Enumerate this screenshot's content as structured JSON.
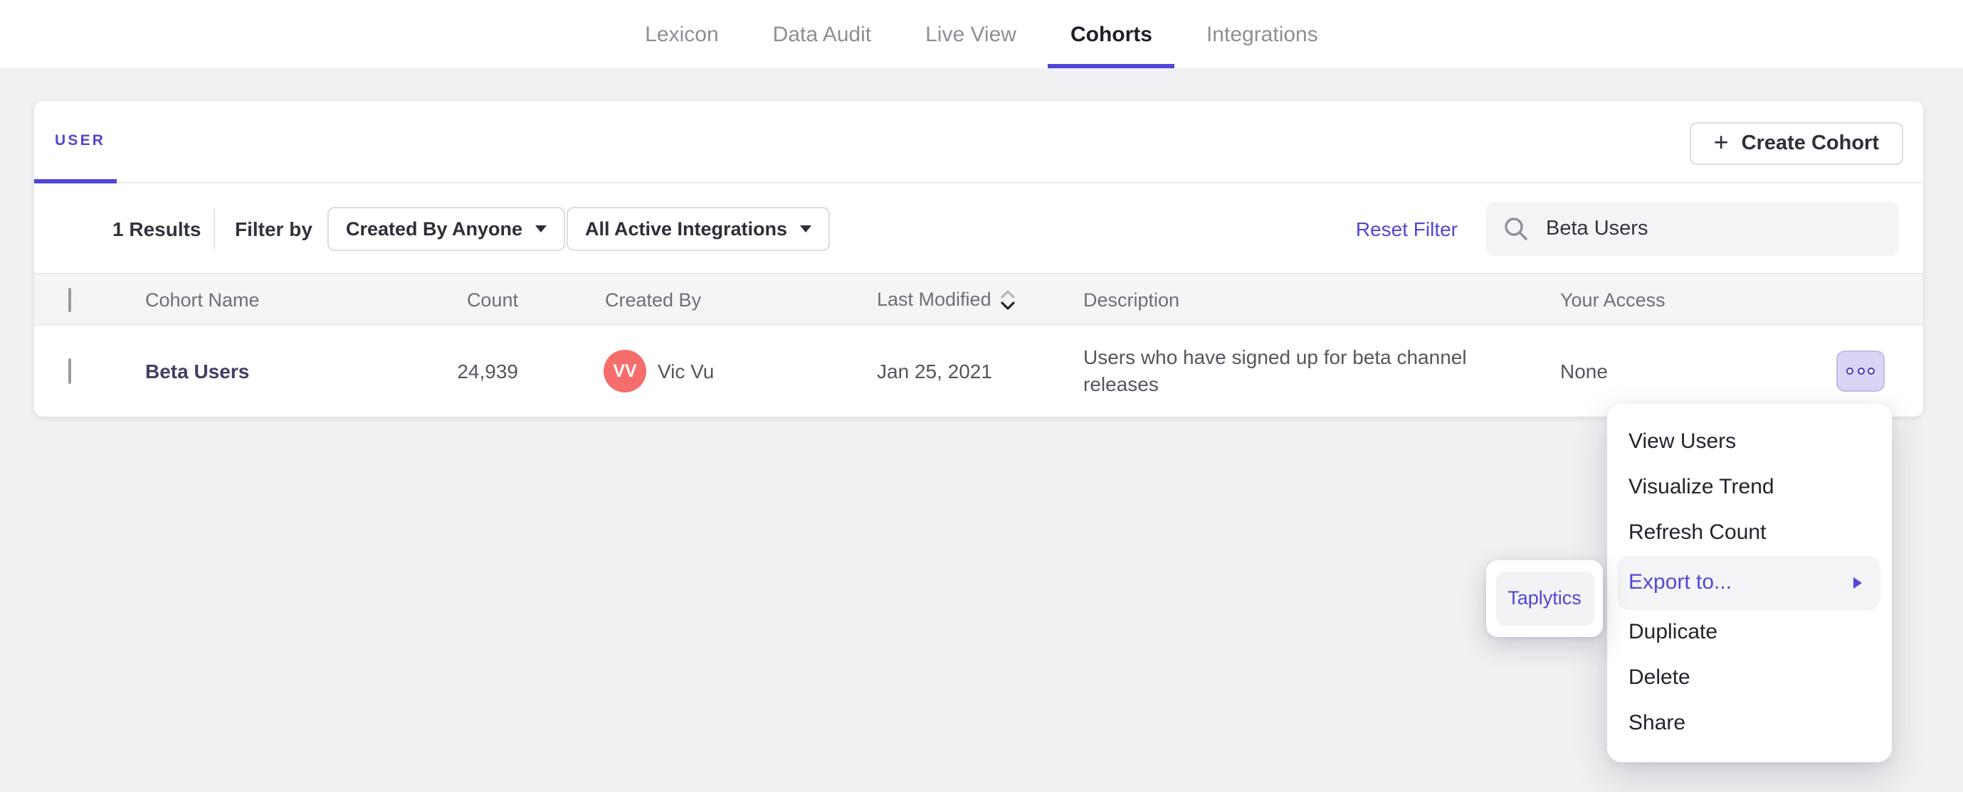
{
  "colors": {
    "accent": "#5246d7",
    "avatar": "#f66d6d",
    "more_button_bg": "#d9d5f4",
    "header_bg": "#f5f5f6",
    "page_bg": "#f1f1f3"
  },
  "icons": {
    "plus": "+",
    "search": "magnifier",
    "dropdown_caret": "caret-down",
    "sort": "up-down-chevrons",
    "more": "three-dots",
    "submenu": "right-triangle"
  },
  "nav": {
    "items": [
      {
        "label": "Lexicon",
        "active": false
      },
      {
        "label": "Data Audit",
        "active": false
      },
      {
        "label": "Live View",
        "active": false
      },
      {
        "label": "Cohorts",
        "active": true
      },
      {
        "label": "Integrations",
        "active": false
      }
    ]
  },
  "panel": {
    "tab_label": "USER",
    "create_button_label": "Create Cohort",
    "results_count": "1 Results",
    "filter_by_label": "Filter by",
    "created_by_filter": "Created By Anyone",
    "integrations_filter": "All Active Integrations",
    "reset_filter_label": "Reset Filter",
    "search_value": "Beta Users",
    "table": {
      "columns": [
        "Cohort Name",
        "Count",
        "Created By",
        "Last Modified",
        "Description",
        "Your Access"
      ],
      "rows": [
        {
          "name": "Beta Users",
          "count": "24,939",
          "avatar_initials": "VV",
          "created_by": "Vic Vu",
          "last_modified": "Jan 25, 2021",
          "description": "Users who have signed up for beta channel releases",
          "your_access": "None"
        }
      ]
    }
  },
  "context_menu": {
    "items": [
      "View Users",
      "Visualize Trend",
      "Refresh Count",
      "Export to...",
      "Duplicate",
      "Delete",
      "Share"
    ],
    "highlighted_item": "Export to..."
  },
  "export_submenu": {
    "items": [
      "Taplytics"
    ]
  }
}
